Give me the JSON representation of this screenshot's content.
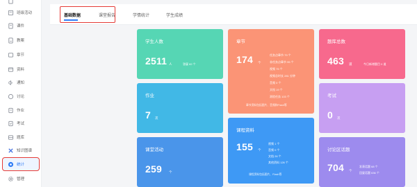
{
  "sidebar": {
    "items": [
      {
        "label": "",
        "icon": "doc-icon"
      },
      {
        "label": "班级活动",
        "icon": "activity-icon"
      },
      {
        "label": "课件",
        "icon": "courseware-icon"
      },
      {
        "label": "教案",
        "icon": "lesson-plan-icon"
      },
      {
        "label": "章节",
        "icon": "chapter-icon"
      },
      {
        "label": "资料",
        "icon": "resource-icon"
      },
      {
        "label": "通知",
        "icon": "notice-icon"
      },
      {
        "label": "讨论",
        "icon": "discussion-icon"
      },
      {
        "label": "作业",
        "icon": "homework-icon"
      },
      {
        "label": "考试",
        "icon": "exam-icon"
      },
      {
        "label": "题库",
        "icon": "question-bank-icon"
      },
      {
        "label": "知识图谱",
        "icon": "knowledge-graph-icon"
      },
      {
        "label": "统计",
        "icon": "statistics-icon"
      },
      {
        "label": "管理",
        "icon": "gear-icon"
      }
    ]
  },
  "tabs": [
    {
      "label": "基础数据"
    },
    {
      "label": "课堂报告"
    },
    {
      "label": "学情统计"
    },
    {
      "label": "学生成绩"
    }
  ],
  "cards": {
    "students": {
      "title": "学生人数",
      "value": "2511",
      "unit": "人",
      "extra": "答疑 82 个"
    },
    "homework": {
      "title": "作业",
      "value": "7",
      "unit": "次"
    },
    "activity": {
      "title": "课堂活动",
      "value": "259",
      "unit": "个"
    },
    "chapter": {
      "title": "章节",
      "value": "174",
      "unit": "个",
      "details": [
        "任务点章节 79 个",
        "非任务点章节 95 个",
        "视频 75 个",
        "视频总时长 281 分钟",
        "音频 0 个",
        "文档 19 个",
        "测验任务 103 个"
      ],
      "foot": "章节资料包括图片、音频和Flash等"
    },
    "resources": {
      "title": "课程资料",
      "value": "155",
      "unit": "个",
      "details": [
        "视频 1 个",
        "音频 0 个",
        "文档 26 个",
        "其他资料 126 个"
      ],
      "foot": "课程资料包括图片、Flash等"
    },
    "questions": {
      "title": "题库总数",
      "value": "463",
      "unit": "道",
      "extra": "今日新增题目 0 道"
    },
    "exam": {
      "title": "考试",
      "value": "0",
      "unit": "次"
    },
    "discussion": {
      "title": "讨论区话题",
      "value": "704",
      "unit": "个",
      "details": [
        "发表话题 68 个",
        "回复话题 636 个"
      ]
    }
  },
  "colors": {
    "accent": "#2f7cf6",
    "highlight": "#e53935",
    "students": "#56d6b4",
    "homework": "#41b8e6",
    "activity": "#4a95ea",
    "chapter": "#fb9476",
    "resources": "#3e99f5",
    "questions": "#f7698d",
    "exam": "#c79ff2",
    "discussion": "#9d8bee"
  }
}
